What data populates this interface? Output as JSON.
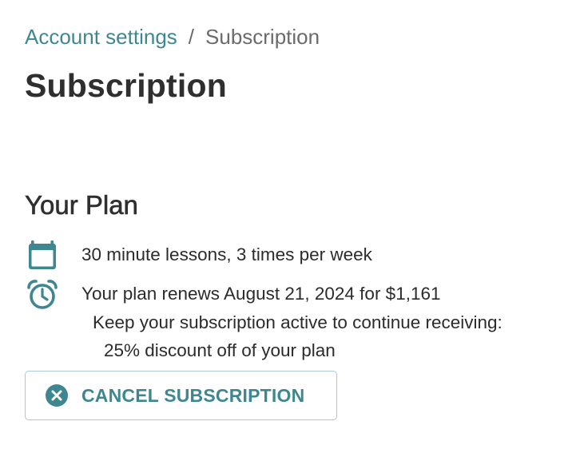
{
  "breadcrumb": {
    "parent": "Account settings",
    "separator": "/",
    "current": "Subscription"
  },
  "page": {
    "title": "Subscription"
  },
  "plan": {
    "heading": "Your Plan",
    "frequency_icon": "calendar-icon",
    "frequency": "30 minute lessons, 3 times per week",
    "renewal_icon": "alarm-clock-icon",
    "renewal": "Your plan renews August 21, 2024 for $1,161",
    "keep_active": "Keep your subscription active to continue receiving:",
    "benefit": "25% discount off of your plan"
  },
  "actions": {
    "cancel_icon": "close-circle-icon",
    "cancel_label": "CANCEL SUBSCRIPTION"
  },
  "colors": {
    "accent": "#3f8790",
    "text": "#2b2b2b",
    "button_border": "#a9c9cf"
  }
}
